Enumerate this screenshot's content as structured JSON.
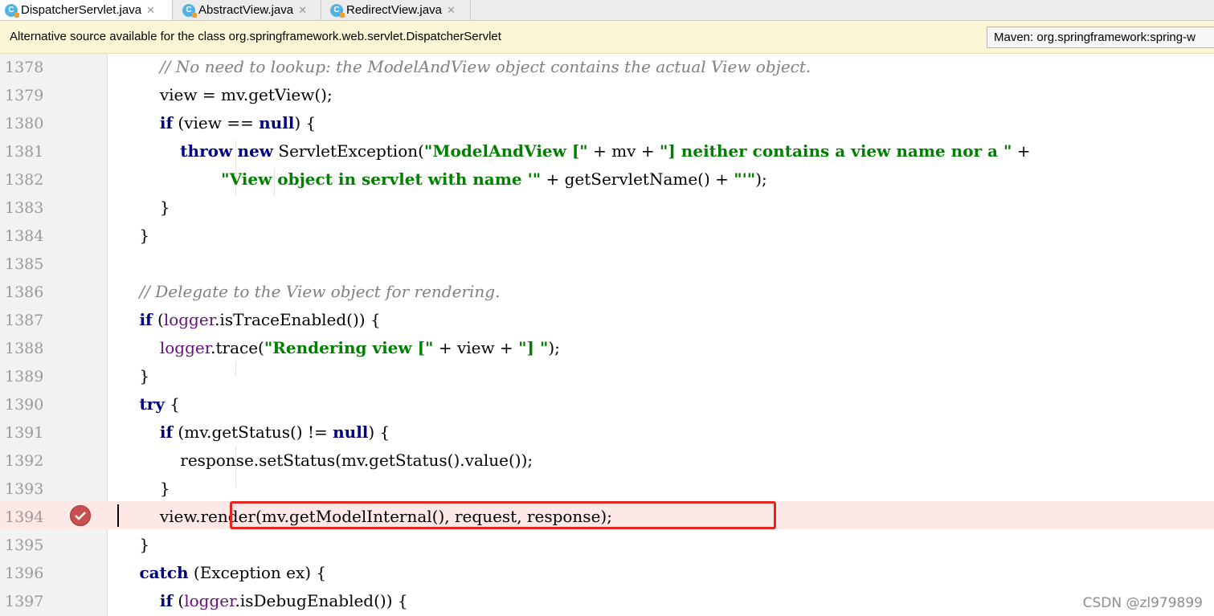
{
  "tabs": [
    {
      "label": "DispatcherServlet.java",
      "icon": "class-icon",
      "active": true
    },
    {
      "label": "AbstractView.java",
      "icon": "class-icon",
      "active": false
    },
    {
      "label": "RedirectView.java",
      "icon": "class-icon",
      "active": false
    }
  ],
  "banner": {
    "message": "Alternative source available for the class org.springframework.web.servlet.DispatcherServlet",
    "maven_select": "Maven: org.springframework:spring-w"
  },
  "editor": {
    "lines": [
      {
        "num": "1378",
        "code": "        // No need to lookup: the ModelAndView object contains the actual View object."
      },
      {
        "num": "1379",
        "code": "        view = mv.getView();"
      },
      {
        "num": "1380",
        "code": "        if (view == null) {"
      },
      {
        "num": "1381",
        "code": "            throw new ServletException(\"ModelAndView [\" + mv + \"] neither contains a view name nor a \" +"
      },
      {
        "num": "1382",
        "code": "                    \"View object in servlet with name '\" + getServletName() + \"'\");"
      },
      {
        "num": "1383",
        "code": "        }"
      },
      {
        "num": "1384",
        "code": "    }"
      },
      {
        "num": "1385",
        "code": ""
      },
      {
        "num": "1386",
        "code": "    // Delegate to the View object for rendering."
      },
      {
        "num": "1387",
        "code": "    if (logger.isTraceEnabled()) {"
      },
      {
        "num": "1388",
        "code": "        logger.trace(\"Rendering view [\" + view + \"] \");"
      },
      {
        "num": "1389",
        "code": "    }"
      },
      {
        "num": "1390",
        "code": "    try {"
      },
      {
        "num": "1391",
        "code": "        if (mv.getStatus() != null) {"
      },
      {
        "num": "1392",
        "code": "            response.setStatus(mv.getStatus().value());"
      },
      {
        "num": "1393",
        "code": "        }"
      },
      {
        "num": "1394",
        "code": "        view.render(mv.getModelInternal(), request, response);"
      },
      {
        "num": "1395",
        "code": "    }"
      },
      {
        "num": "1396",
        "code": "    catch (Exception ex) {"
      },
      {
        "num": "1397",
        "code": "        if (logger.isDebugEnabled()) {"
      }
    ],
    "current_line": "1394",
    "breakpoint_line": "1394"
  },
  "watermark": "CSDN @zl979899",
  "colors": {
    "keyword": "#000080",
    "string": "#008000",
    "comment": "#808080",
    "field": "#660e7a",
    "highlight_box": "#e5261f",
    "current_line_bg": "#fce8e6",
    "breakpoint": "#c95050"
  }
}
